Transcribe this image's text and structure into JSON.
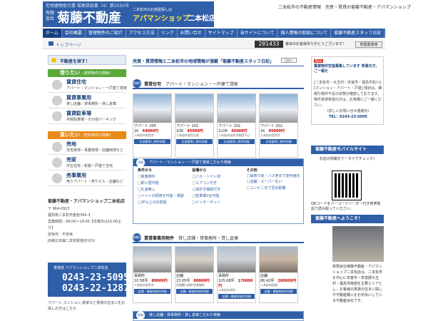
{
  "header": {
    "license": "宅地建物取引業 福島県知事（4）第2550号",
    "company_type": "有限会社",
    "company_name": "菊藤不動産",
    "shop_tag": "二本松市のお部屋探しは",
    "shop_name": "アパマンショップ",
    "branch": "二本松店",
    "tagline": "二本松市の不動産情報　売買・賃貸の菊藤不動産・アパマンショップ"
  },
  "nav": [
    {
      "label": "ホーム"
    },
    {
      "label": "会社概要"
    },
    {
      "label": "管理物件のご紹介"
    },
    {
      "label": "アクセス方法"
    },
    {
      "label": "リンク"
    },
    {
      "label": "お問い合せ"
    },
    {
      "label": "サイトマップ"
    },
    {
      "label": "当サイトについて"
    },
    {
      "label": "個人情報の取扱について"
    },
    {
      "label": "菊藤不動産スタッフ日記"
    }
  ],
  "breadcrumb": "トップページ",
  "counter": "201433",
  "welcome": "番目のお客様ありがとうございます！",
  "member_button": "管理者専用",
  "sidebar": {
    "heading": "不動産を探す！",
    "rent_title": "借りたい",
    "rent_sub": "(賃貸物件の検索)",
    "rent_items": [
      {
        "title": "賃貸住宅",
        "desc": "アパート・マンション・一戸建て貸家"
      },
      {
        "title": "賃貸事業用",
        "desc": "貸し店舗・貸事務所・貸し倉庫"
      },
      {
        "title": "賃貸駐車場",
        "desc": "月極駐車場・その他パーキング"
      }
    ],
    "buy_title": "買いたい",
    "buy_sub": "(売買物件の検索)",
    "buy_items": [
      {
        "title": "売地",
        "desc": "住宅用地・事業用地・店舗用地など"
      },
      {
        "title": "売家",
        "desc": "中古住宅・新築一戸建て住宅"
      },
      {
        "title": "売事業用",
        "desc": "売りアパート・売りビル・店舗など"
      }
    ]
  },
  "info": {
    "title": "菊藤不動産・アパマンショップ二本松店",
    "lines": [
      "〒 964-0915",
      "福島県二本松市金色395-3",
      "営業時間：09:00～19:00【日曜日は10:00より】",
      "定休日：不定休",
      "JR東北本線二本松駅徒歩10分"
    ]
  },
  "contact": {
    "title": "賃貸部 アパマンショップ二本松店",
    "phone1": "0243-23-5095",
    "phone2": "0243-22-1287"
  },
  "footnote": "アパート,マンション,賃家など賃貸の住まいをお探しの方はこちら",
  "notice": {
    "text": "売買・賃貸情報と二本松市の地域情報が満載「菊藤不動産スタッフ日記」",
    "button": "日記へ"
  },
  "residential": {
    "badge": "賃貸住宅",
    "title": "賃貸住宅",
    "sub": "アパート・マンション・一戸建て貸家",
    "cards": [
      {
        "name": "アパート 205",
        "layout": "1K",
        "price": "44000円",
        "addr": "二本松市金色字",
        "btn": "お部屋探し物件詳細"
      },
      {
        "name": "アパート 102",
        "layout": "1DK",
        "price": "45000円",
        "addr": "二本松市金色久保",
        "btn": "お部屋探し物件詳細"
      },
      {
        "name": "アパート 102",
        "layout": "1LDK",
        "price": "45000円",
        "addr": "二本松市油井字東田下山",
        "btn": "お部屋探し物件詳細"
      },
      {
        "name": "アパート 202",
        "layout": "1K",
        "price": "45000円",
        "addr": "二本松市金色字",
        "btn": "お部屋探し物件詳細"
      }
    ]
  },
  "search1": {
    "badge": "詳細",
    "title": "アパート・マンション・一戸建て貸家こだわり検索",
    "col1_title": "条件から",
    "col1": [
      "新築物件",
      "即入居可能",
      "礼金無し",
      "ペットの飼育が可能・相談",
      "2F以上のお部屋"
    ],
    "col2_title": "設備から",
    "col2": [
      "バス・トイレ別",
      "エアコン付き",
      "追炊き機能付き",
      "駐車場2台可能",
      "インターネット"
    ],
    "col3_title": "その他",
    "col3": [
      "最寄り駅・バス停まで徒歩圏内",
      "店舗・スーパー近い",
      "コンビニまで至近距離"
    ]
  },
  "business": {
    "badge": "事業用",
    "title": "賃貸事業用物件",
    "sub": "貸し店舗・貸事務所・貸し倉庫",
    "cards": [
      {
        "name": "事務所",
        "layout": "10.58坪",
        "price": "80000円",
        "addr": "二本松市金色字",
        "btn": "店舗・事務所物件詳細"
      },
      {
        "name": "店舗",
        "layout": "23.05坪",
        "price": "80000円",
        "addr": "伊達郡川俣町字鉄砲町",
        "btn": "店舗・事務所物件詳細"
      },
      {
        "name": "事務所",
        "layout": "105.68坪",
        "price": "170000円",
        "addr": "二本松市本町",
        "btn": "店舗・事務所物件詳細"
      },
      {
        "name": "店舗",
        "layout": "86.42坪",
        "price": "280000円",
        "addr": "二本松市松岡",
        "btn": "店舗・事務所物件詳細"
      }
    ]
  },
  "search2": {
    "badge": "詳細",
    "title": "貸し店舗・貸事務所・貸し倉庫こだわり検索"
  },
  "right": {
    "ad_new": "New",
    "ad_head": "賃貸物件空室募集しています 希望の方、ご一報を",
    "ad_body": "[二本松市・大玉村・本宮市・福島市松川] [マンション・アパート・戸建] 現状は、輝綱な物件不足の状態が継続しております。物件賃貸希望の方は、お気軽にご一報ください。",
    "ad_contact": "(詳しいお問い合せ連絡先)",
    "ad_phone": "TEL：0243-23-5095",
    "mobile_title": "菊藤不動産モバイルサイト",
    "mobile_note": "お店の情報をケータイでチェック♪",
    "qr_note": "QRコードをバーコードリーダー付き携帯電話で読み取ってください。",
    "welcome_title": "菊藤不動産へようこそ！",
    "about": "有限会社菊藤不動産・アパマンショップ二本松店は、二本松市を中心に本宮市・安達郡大玉村・福島市南部を主要エリアとし、お客様の賃貸の住まい探しや不動産購入をお手伝いしている不動産会社です。"
  }
}
